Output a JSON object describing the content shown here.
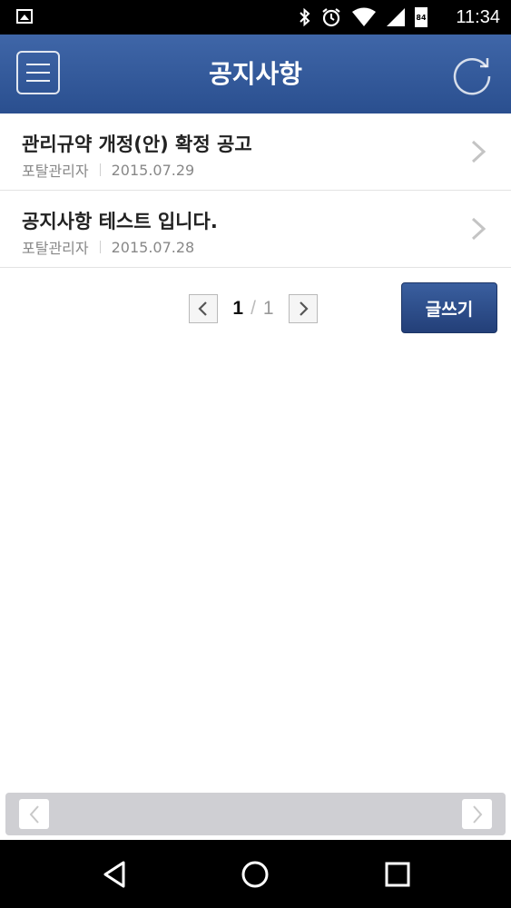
{
  "status_bar": {
    "time": "11:34",
    "battery_level": "84",
    "icons": [
      "image-icon",
      "bluetooth-icon",
      "alarm-icon",
      "wifi-icon",
      "signal-icon",
      "battery-icon"
    ]
  },
  "header": {
    "title": "공지사항",
    "menu_icon": "hamburger-menu-icon",
    "refresh_icon": "refresh-icon",
    "color": "#2f5596"
  },
  "notices": [
    {
      "title": "관리규약 개정(안) 확정 공고",
      "author": "포탈관리자",
      "date": "2015.07.29"
    },
    {
      "title": "공지사항 테스트 입니다.",
      "author": "포탈관리자",
      "date": "2015.07.28"
    }
  ],
  "pagination": {
    "current": "1",
    "total": "1",
    "separator": "/"
  },
  "write_button": {
    "label": "글쓰기"
  }
}
